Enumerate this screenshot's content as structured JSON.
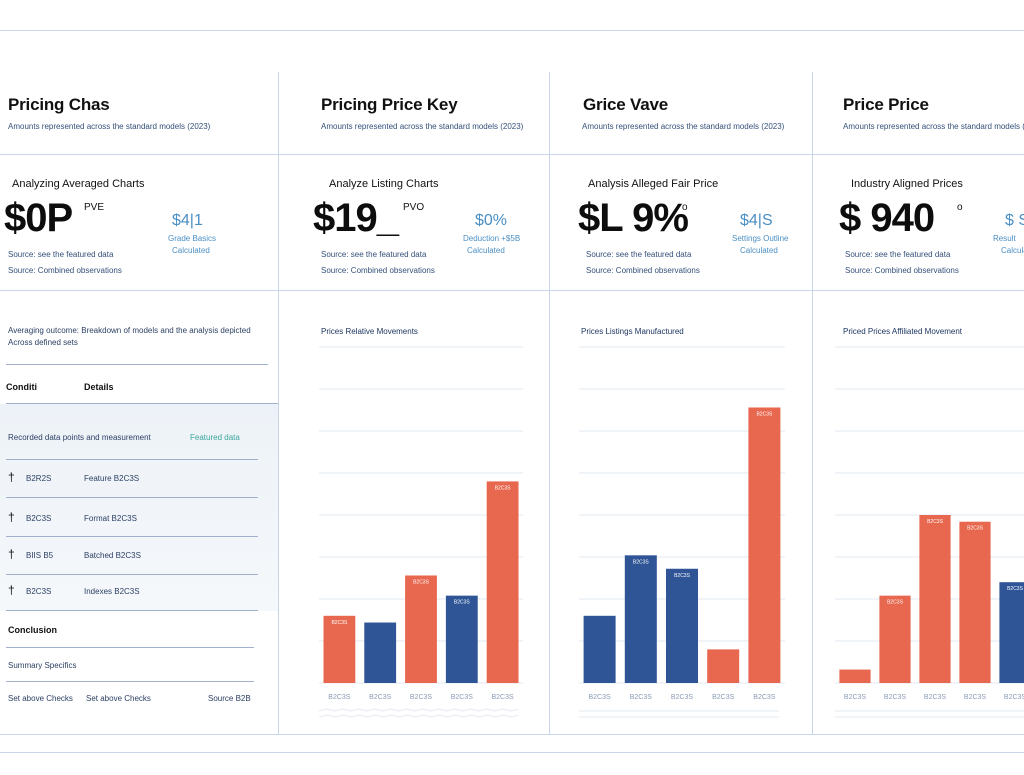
{
  "colors": {
    "blue": "#2f5597",
    "red": "#e8684f",
    "accent": "#4a8fc4",
    "rule": "#c9d6ea"
  },
  "left": {
    "title": "Pricing Chas",
    "subtitle": "Amounts represented across the standard models (2023)",
    "kpi_label": "Analyzing Averaged Charts",
    "kpi_value": "$0P",
    "kpi_sup": "PVE",
    "side_value": "$4|1",
    "side_sub1": "Grade Basics",
    "side_sub2": "Calculated",
    "note1": "Source: see the featured data",
    "note2": "Source: Combined observations",
    "desc1": "Averaging outcome: Breakdown of models and the analysis depicted",
    "desc2": "Across defined sets",
    "table_header_1": "Conditi",
    "table_header_2": "Details",
    "table_caption": "Recorded data points and measurement",
    "table_caption_right": "Featured data",
    "rows": [
      {
        "icon": "pin-icon",
        "col1": "B2R2S",
        "col2": "Feature B2C3S"
      },
      {
        "icon": "pin-icon",
        "col1": "B2C3S",
        "col2": "Format B2C3S"
      },
      {
        "icon": "pin-icon",
        "col1": "BIIS B5",
        "col2": "Batched B2C3S"
      },
      {
        "icon": "pin-icon",
        "col1": "B2C3S",
        "col2": "Indexes B2C3S"
      }
    ],
    "footer_label": "Conclusion",
    "footer_note": "Summary Specifics",
    "footer_left_1": "Set above Checks",
    "footer_left_2": "Set above Checks",
    "footer_right": "Source B2B"
  },
  "panels": [
    {
      "title": "Pricing Price Key",
      "subtitle": "Amounts represented across the standard models (2023)",
      "kpi_label": "Analyze Listing Charts",
      "kpi_value": "$19_",
      "kpi_sup": "PVO",
      "side_value": "$0%",
      "side_sub1": "Deduction +$5B",
      "side_sub2": "Calculated",
      "note1": "Source: see the featured data",
      "note2": "Source: Combined observations",
      "chart_title": "Prices Relative Movements"
    },
    {
      "title": "Grice Vave",
      "subtitle": "Amounts represented across the standard models (2023)",
      "kpi_label": "Analysis Alleged Fair Price",
      "kpi_value": "$L 9%",
      "kpi_sup": "o",
      "side_value": "$4|S",
      "side_sub1": "Settings Outline",
      "side_sub2": "Calculated",
      "note1": "Source: see the featured data",
      "note2": "Source: Combined observations",
      "chart_title": "Prices Listings Manufactured"
    },
    {
      "title": "Price Price",
      "subtitle": "Amounts represented across the standard models (2023)",
      "kpi_label": "Industry Aligned Prices",
      "kpi_value": "$ 940",
      "kpi_sup": "o",
      "side_value": "$ S",
      "side_sub1": "Result",
      "side_sub2": "Calculated",
      "note1": "Source: see the featured data",
      "note2": "Source: Combined observations",
      "chart_title": "Priced Prices Affiliated Movement"
    }
  ],
  "chart_data": [
    {
      "type": "bar",
      "categories": [
        "B2C3S",
        "B2C3S",
        "B2C3S",
        "B2C3S",
        "B2C3S"
      ],
      "bar_labels": [
        "B2C3S",
        "",
        "B2C3S",
        "B2C3S",
        "B2C3S"
      ],
      "values": [
        10,
        9,
        16,
        13,
        30
      ],
      "colors": [
        "red",
        "blue",
        "red",
        "blue",
        "red"
      ],
      "ylim": [
        0,
        50
      ]
    },
    {
      "type": "bar",
      "categories": [
        "B2C3S",
        "B2C3S",
        "B2C3S",
        "B2C3S",
        "B2C3S"
      ],
      "bar_labels": [
        "",
        "B2C3S",
        "B2C3S",
        "",
        "B2C3S"
      ],
      "values": [
        10,
        19,
        17,
        5,
        41
      ],
      "colors": [
        "blue",
        "blue",
        "blue",
        "red",
        "red"
      ],
      "ylim": [
        0,
        50
      ]
    },
    {
      "type": "bar",
      "categories": [
        "B2C3S",
        "B2C3S",
        "B2C3S",
        "B2C3S",
        "B2C3S"
      ],
      "bar_labels": [
        "",
        "B2C3S",
        "B2C3S",
        "B2C3S",
        "B2C3S"
      ],
      "values": [
        2,
        13,
        25,
        24,
        15
      ],
      "colors": [
        "red",
        "red",
        "red",
        "red",
        "blue"
      ],
      "ylim": [
        0,
        50
      ]
    }
  ]
}
